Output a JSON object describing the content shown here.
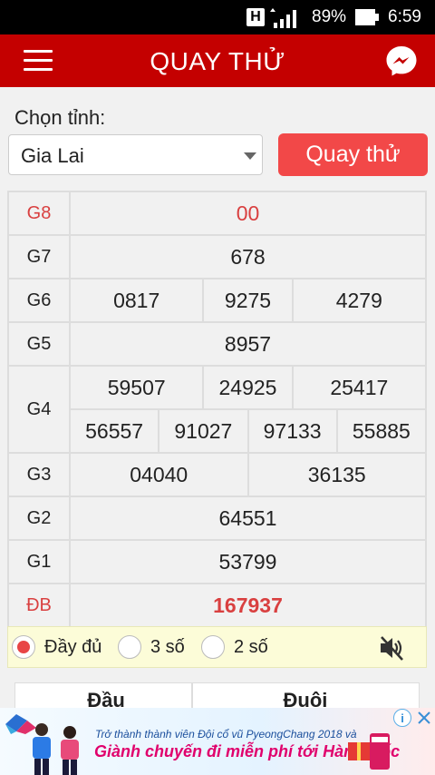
{
  "status_bar": {
    "network_type": "H",
    "battery_percent": "89%",
    "time": "6:59",
    "icons": [
      "h-network-icon",
      "signal-icon",
      "battery-icon"
    ]
  },
  "app_bar": {
    "title": "QUAY THỬ",
    "icons": [
      "menu-icon",
      "messenger-icon"
    ],
    "color": "#c40000"
  },
  "form": {
    "province_label": "Chọn tỉnh:",
    "province_selected": "Gia Lai",
    "spin_button": "Quay thử"
  },
  "results": {
    "g8": {
      "label": "G8",
      "values": [
        "00"
      ]
    },
    "g7": {
      "label": "G7",
      "values": [
        "678"
      ]
    },
    "g6": {
      "label": "G6",
      "values": [
        "0817",
        "9275",
        "4279"
      ]
    },
    "g5": {
      "label": "G5",
      "values": [
        "8957"
      ]
    },
    "g4": {
      "label": "G4",
      "values": [
        "59507",
        "24925",
        "25417",
        "56557",
        "91027",
        "97133",
        "55885"
      ]
    },
    "g3": {
      "label": "G3",
      "values": [
        "04040",
        "36135"
      ]
    },
    "g2": {
      "label": "G2",
      "values": [
        "64551"
      ]
    },
    "g1": {
      "label": "G1",
      "values": [
        "53799"
      ]
    },
    "db": {
      "label": "ĐB",
      "values": [
        "167937"
      ]
    },
    "highlight_color": "#d94040"
  },
  "display_options": {
    "items": [
      {
        "label": "Đầy đủ",
        "selected": true
      },
      {
        "label": "3 số",
        "selected": false
      },
      {
        "label": "2 số",
        "selected": false
      }
    ],
    "mute_icon": "speaker-muted-icon"
  },
  "bottom_tabs": [
    "Đầu",
    "Đuôi"
  ],
  "ad": {
    "line1": "Trở thành thành viên Đội cổ vũ PyeongChang 2018 và",
    "line2": "Giành chuyến đi miễn phí tới Hàn Quốc",
    "info_icon": "i"
  }
}
